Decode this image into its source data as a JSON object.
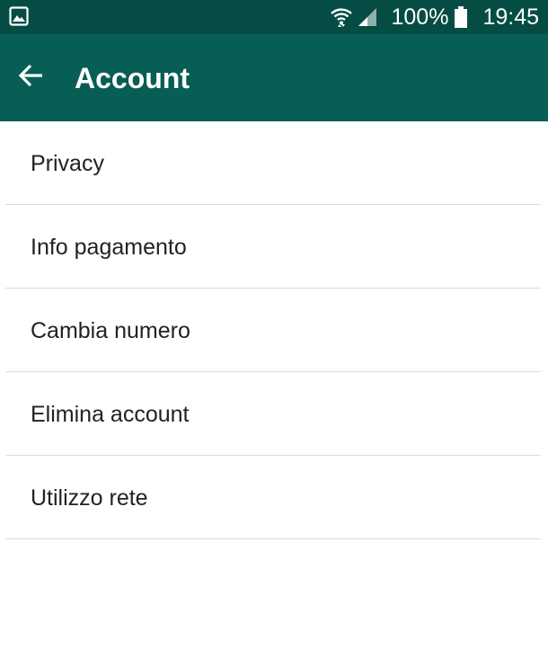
{
  "status_bar": {
    "battery_percent": "100%",
    "time": "19:45",
    "icons": [
      "image-notification-icon",
      "wifi-icon",
      "signal-icon",
      "battery-icon"
    ]
  },
  "app_bar": {
    "title": "Account",
    "back_icon": "arrow-left-icon"
  },
  "menu": {
    "items": [
      {
        "label": "Privacy"
      },
      {
        "label": "Info pagamento"
      },
      {
        "label": "Cambia numero"
      },
      {
        "label": "Elimina account"
      },
      {
        "label": "Utilizzo rete"
      }
    ]
  },
  "colors": {
    "status_bar": "#054d44",
    "app_bar": "#075e54",
    "divider": "#dcdcdc",
    "text": "#222222"
  }
}
